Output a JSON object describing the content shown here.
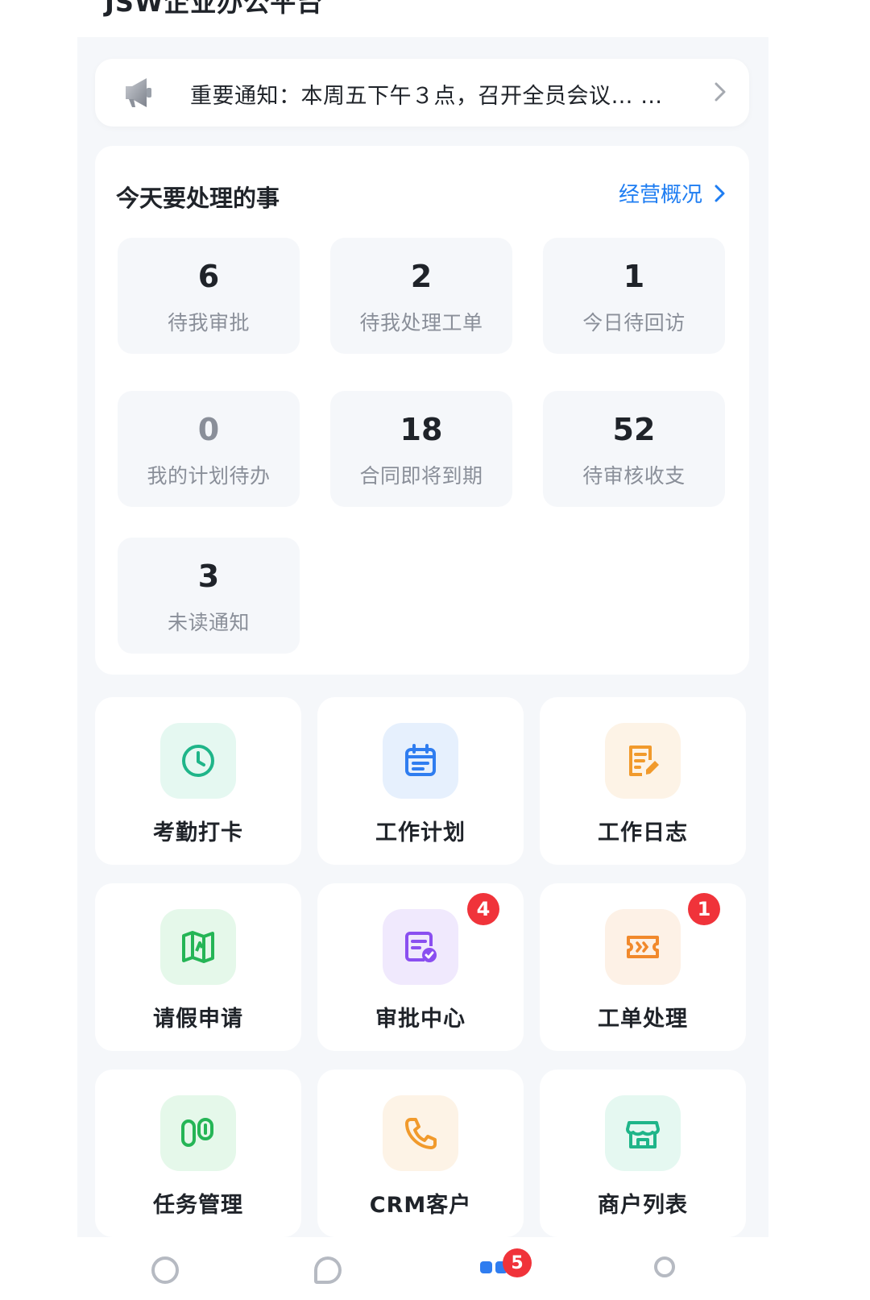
{
  "app": {
    "title": "JSW企业办公平台"
  },
  "notice": {
    "text": "重要通知：本周五下午３点，召开全员会议… …",
    "icons": {
      "lead": "megaphone-icon",
      "trail": "chevron-right-icon"
    }
  },
  "todo": {
    "title": "今天要处理的事",
    "link_label": "经营概况",
    "stats": [
      {
        "value": "6",
        "label": "待我审批"
      },
      {
        "value": "2",
        "label": "待我处理工单"
      },
      {
        "value": "1",
        "label": "今日待回访"
      },
      {
        "value": "0",
        "label": "我的计划待办"
      },
      {
        "value": "18",
        "label": "合同即将到期"
      },
      {
        "value": "52",
        "label": "待审核收支"
      },
      {
        "value": "3",
        "label": "未读通知"
      }
    ]
  },
  "apps": [
    {
      "label": "考勤打卡",
      "icon": "clock-icon",
      "color": "#1fb589",
      "bg": "#e5f8f1"
    },
    {
      "label": "工作计划",
      "icon": "calendar-icon",
      "color": "#2f7df0",
      "bg": "#e6f0fd"
    },
    {
      "label": "工作日志",
      "icon": "journal-icon",
      "color": "#f19a2c",
      "bg": "#fdf3e6"
    },
    {
      "label": "请假申请",
      "icon": "map-icon",
      "color": "#25b556",
      "bg": "#e5f8ea"
    },
    {
      "label": "审批中心",
      "icon": "approval-icon",
      "color": "#8a4ff0",
      "bg": "#f0e9fd",
      "badge": "4"
    },
    {
      "label": "工单处理",
      "icon": "ticket-icon",
      "color": "#f1892c",
      "bg": "#fdf1e6",
      "badge": "1"
    },
    {
      "label": "任务管理",
      "icon": "task-icon",
      "color": "#25b556",
      "bg": "#e5f8ea"
    },
    {
      "label": "CRM客户",
      "icon": "phone-icon",
      "color": "#f19a2c",
      "bg": "#fdf3e6"
    },
    {
      "label": "商户列表",
      "icon": "store-icon",
      "color": "#1fb589",
      "bg": "#e5f8f1"
    }
  ],
  "tabbar": {
    "badge": "5"
  }
}
